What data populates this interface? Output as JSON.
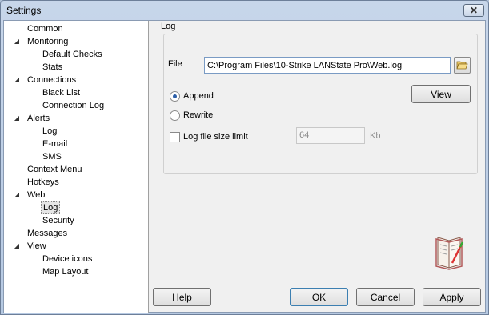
{
  "window": {
    "title": "Settings"
  },
  "tree": {
    "items": [
      {
        "label": "Common",
        "level": 0,
        "expandable": false
      },
      {
        "label": "Monitoring",
        "level": 0,
        "expandable": true
      },
      {
        "label": "Default Checks",
        "level": 1
      },
      {
        "label": "Stats",
        "level": 1
      },
      {
        "label": "Connections",
        "level": 0,
        "expandable": true
      },
      {
        "label": "Black List",
        "level": 1
      },
      {
        "label": "Connection Log",
        "level": 1
      },
      {
        "label": "Alerts",
        "level": 0,
        "expandable": true
      },
      {
        "label": "Log",
        "level": 1
      },
      {
        "label": "E-mail",
        "level": 1
      },
      {
        "label": "SMS",
        "level": 1
      },
      {
        "label": "Context Menu",
        "level": 0,
        "expandable": false
      },
      {
        "label": "Hotkeys",
        "level": 0,
        "expandable": false
      },
      {
        "label": "Web",
        "level": 0,
        "expandable": true
      },
      {
        "label": "Log",
        "level": 1,
        "selected": true
      },
      {
        "label": "Security",
        "level": 1
      },
      {
        "label": "Messages",
        "level": 0,
        "expandable": false
      },
      {
        "label": "View",
        "level": 0,
        "expandable": true
      },
      {
        "label": "Device icons",
        "level": 1
      },
      {
        "label": "Map Layout",
        "level": 1
      }
    ]
  },
  "log": {
    "group_label": "Log",
    "file_label": "File",
    "file_value": "C:\\Program Files\\10-Strike LANState Pro\\Web.log",
    "append_label": "Append",
    "rewrite_label": "Rewrite",
    "append_checked": true,
    "view_label": "View",
    "size_limit_label": "Log file size limit",
    "size_limit_checked": false,
    "size_value": "64",
    "size_unit": "Kb"
  },
  "buttons": {
    "help": "Help",
    "ok": "OK",
    "cancel": "Cancel",
    "apply": "Apply"
  },
  "colors": {
    "selection": "#e6e6e6",
    "accent": "#2d5fa8"
  },
  "icons": {
    "browse": "open-folder-icon",
    "book": "book-icon",
    "close": "close-icon"
  }
}
